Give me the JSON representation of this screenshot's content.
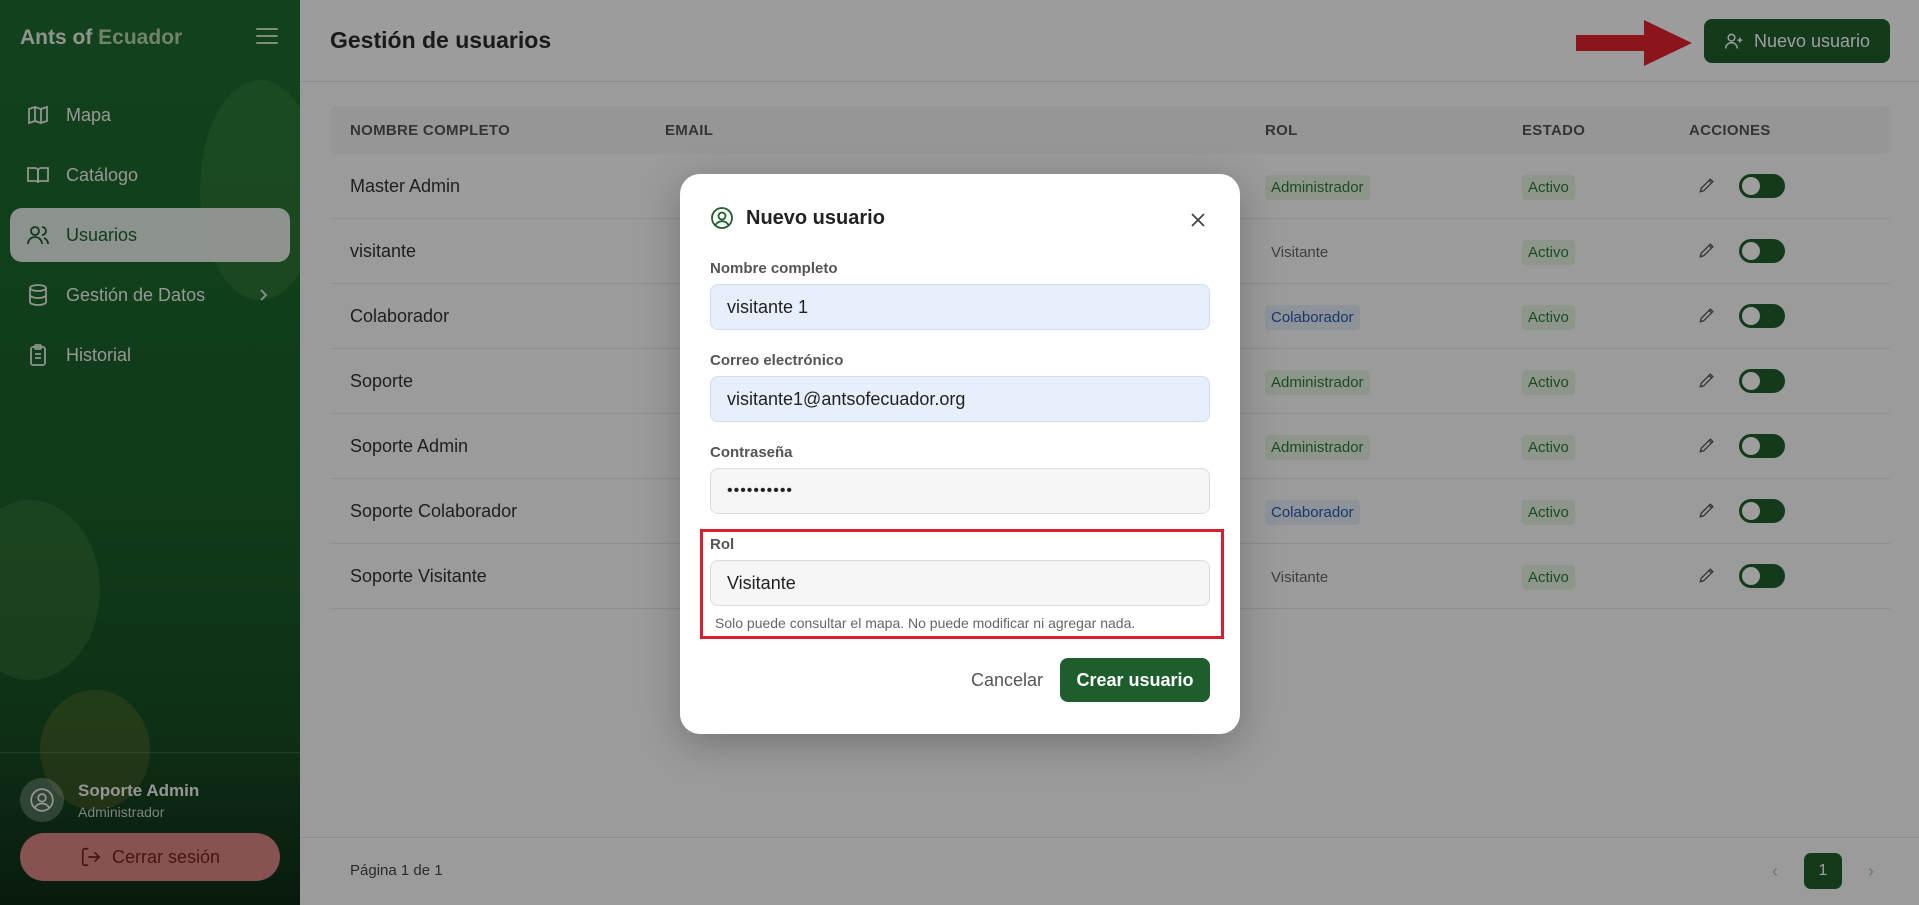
{
  "app": {
    "brand_part1": "Ants of",
    "brand_part2": "Ecuador"
  },
  "sidebar": {
    "items": [
      {
        "label": "Mapa",
        "icon": "map-icon"
      },
      {
        "label": "Catálogo",
        "icon": "book-icon"
      },
      {
        "label": "Usuarios",
        "icon": "users-icon"
      },
      {
        "label": "Gestión de Datos",
        "icon": "database-icon"
      },
      {
        "label": "Historial",
        "icon": "clipboard-icon"
      }
    ],
    "user": {
      "name": "Soporte Admin",
      "role": "Administrador"
    },
    "logout_label": "Cerrar sesión"
  },
  "header": {
    "title": "Gestión de usuarios",
    "new_user_label": "Nuevo usuario"
  },
  "table": {
    "columns": [
      "NOMBRE COMPLETO",
      "EMAIL",
      "ROL",
      "ESTADO",
      "ACCIONES"
    ],
    "rows": [
      {
        "name": "Master Admin",
        "rol": "Administrador",
        "estado": "Activo"
      },
      {
        "name": "visitante",
        "rol": "Visitante",
        "estado": "Activo"
      },
      {
        "name": "Colaborador",
        "rol": "Colaborador",
        "estado": "Activo"
      },
      {
        "name": "Soporte",
        "rol": "Administrador",
        "estado": "Activo"
      },
      {
        "name": "Soporte Admin",
        "rol": "Administrador",
        "estado": "Activo"
      },
      {
        "name": "Soporte Colaborador",
        "rol": "Colaborador",
        "estado": "Activo"
      },
      {
        "name": "Soporte Visitante",
        "rol": "Visitante",
        "estado": "Activo"
      }
    ]
  },
  "footer": {
    "page_info": "Página 1 de 1",
    "current_page": "1"
  },
  "modal": {
    "title": "Nuevo usuario",
    "name_label": "Nombre completo",
    "name_value": "visitante 1",
    "email_label": "Correo electrónico",
    "email_value": "visitante1@antsofecuador.org",
    "password_label": "Contraseña",
    "password_value": "••••••••••",
    "rol_label": "Rol",
    "rol_value": "Visitante",
    "rol_hint": "Solo puede consultar el mapa. No puede modificar ni agregar nada.",
    "cancel_label": "Cancelar",
    "create_label": "Crear usuario"
  },
  "colors": {
    "brand_green": "#1d5e2c",
    "annotation_red": "#d6202b"
  }
}
